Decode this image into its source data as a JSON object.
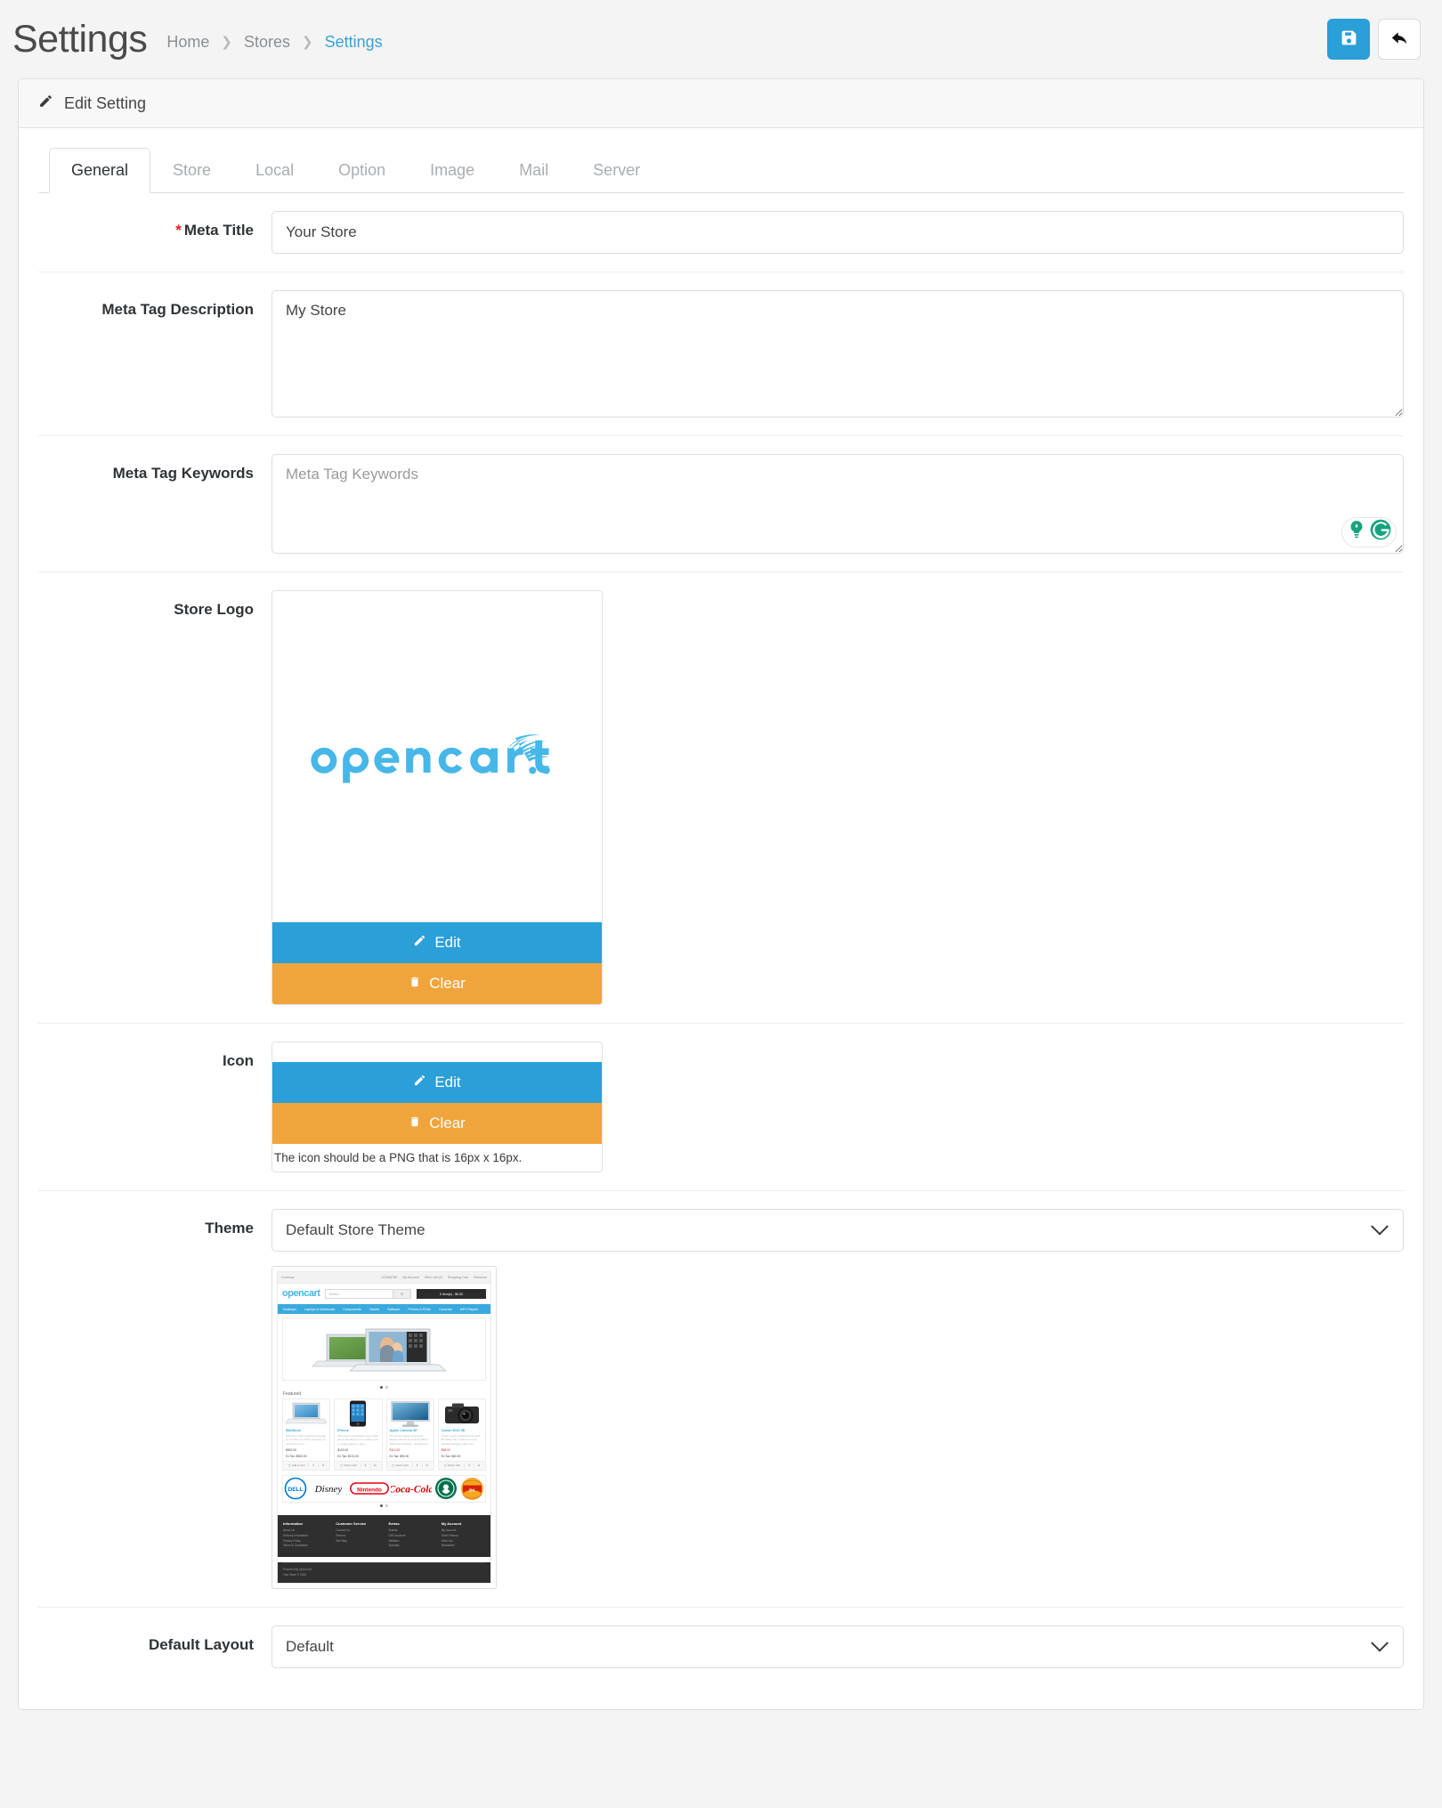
{
  "header": {
    "title": "Settings",
    "breadcrumb": [
      {
        "label": "Home",
        "current": false
      },
      {
        "label": "Stores",
        "current": false
      },
      {
        "label": "Settings",
        "current": true
      }
    ],
    "save_title": "Save",
    "back_title": "Back",
    "accent_blue": "#2a9fd8",
    "link_blue": "#3aa1d4"
  },
  "panel": {
    "heading": "Edit Setting",
    "heading_icon": "pencil-icon"
  },
  "tabs": [
    {
      "label": "General",
      "active": true
    },
    {
      "label": "Store",
      "active": false
    },
    {
      "label": "Local",
      "active": false
    },
    {
      "label": "Option",
      "active": false
    },
    {
      "label": "Image",
      "active": false
    },
    {
      "label": "Mail",
      "active": false
    },
    {
      "label": "Server",
      "active": false
    }
  ],
  "form": {
    "meta_title": {
      "label": "Meta Title",
      "required": true,
      "required_marker": "*",
      "value": "Your Store"
    },
    "meta_description": {
      "label": "Meta Tag Description",
      "value": "My Store"
    },
    "meta_keywords": {
      "label": "Meta Tag Keywords",
      "value": "",
      "placeholder": "Meta Tag Keywords",
      "extension_icons": [
        "grammarly-lightbulb-icon",
        "grammarly-g-icon"
      ],
      "extension_color": "#15a37f"
    },
    "store_logo": {
      "label": "Store Logo",
      "image_alt": "opencart",
      "edit_label": "Edit",
      "clear_label": "Clear",
      "edit_icon": "pencil-icon",
      "clear_icon": "trash-icon",
      "edit_color": "#2a9fd8",
      "clear_color": "#f0a53c"
    },
    "icon": {
      "label": "Icon",
      "edit_label": "Edit",
      "clear_label": "Clear",
      "edit_icon": "pencil-icon",
      "clear_icon": "trash-icon",
      "help_text": "The icon should be a PNG that is 16px x 16px."
    },
    "theme": {
      "label": "Theme",
      "value": "Default Store Theme",
      "options": [
        "Default Store Theme"
      ]
    },
    "default_layout": {
      "label": "Default Layout",
      "value": "Default",
      "options": [
        "Default"
      ]
    }
  },
  "theme_preview": {
    "topbar_left": "Currency",
    "topbar_right": [
      "123456789",
      "My Account",
      "Wish List (0)",
      "Shopping Cart",
      "Checkout"
    ],
    "logo": "opencart",
    "search_placeholder": "Search",
    "cart_label": "0 item(s) - $0.00",
    "nav": [
      "Desktops",
      "Laptops & Notebooks",
      "Components",
      "Tablets",
      "Software",
      "Phones & PDAs",
      "Cameras",
      "MP3 Players"
    ],
    "featured_title": "Featured",
    "products": [
      {
        "name": "MacBook",
        "desc": "Intel Core 2 Duo processor Powered by an Intel Core 2 Duo processor at speeds up to 2.1...",
        "price": "$602.00",
        "tax": "Ex Tax: $500.00",
        "old": ""
      },
      {
        "name": "iPhone",
        "desc": "iPhone is a revolutionary new mobile phone that allows you to make a call by simply tapping a nam...",
        "price": "$123.20",
        "tax": "Ex Tax: $101.00",
        "old": ""
      },
      {
        "name": "Apple Cinema 30\"",
        "desc": "The 30-inch Apple Cinema HD Display delivers an amazing 2560 x 1600 pixel resolution. Designed sp...",
        "price": "$110.00",
        "tax": "Ex Tax: $90.00",
        "old": "$122.00"
      },
      {
        "name": "Canon EOS 5D",
        "desc": "Canon's press material for the EOS 5D states that it 'defines (a new) standard category, while som...",
        "price": "$98.00",
        "tax": "Ex Tax: $80.00",
        "old": "$122.00"
      }
    ],
    "brands": [
      "Dell",
      "Disney",
      "Nintendo",
      "Coca Cola",
      "Starbucks",
      "Burger King"
    ],
    "footer_columns": [
      {
        "head": "Information",
        "links": [
          "About Us",
          "Delivery Information",
          "Privacy Policy",
          "Terms & Conditions"
        ]
      },
      {
        "head": "Customer Service",
        "links": [
          "Contact Us",
          "Returns",
          "Site Map"
        ]
      },
      {
        "head": "Extras",
        "links": [
          "Brands",
          "Gift Vouchers",
          "Affiliates",
          "Specials"
        ]
      },
      {
        "head": "My Account",
        "links": [
          "My Account",
          "Order History",
          "Wish List",
          "Newsletter"
        ]
      }
    ],
    "footer_bottom": [
      "Powered By OpenCart",
      "Your Store © 2024"
    ]
  }
}
